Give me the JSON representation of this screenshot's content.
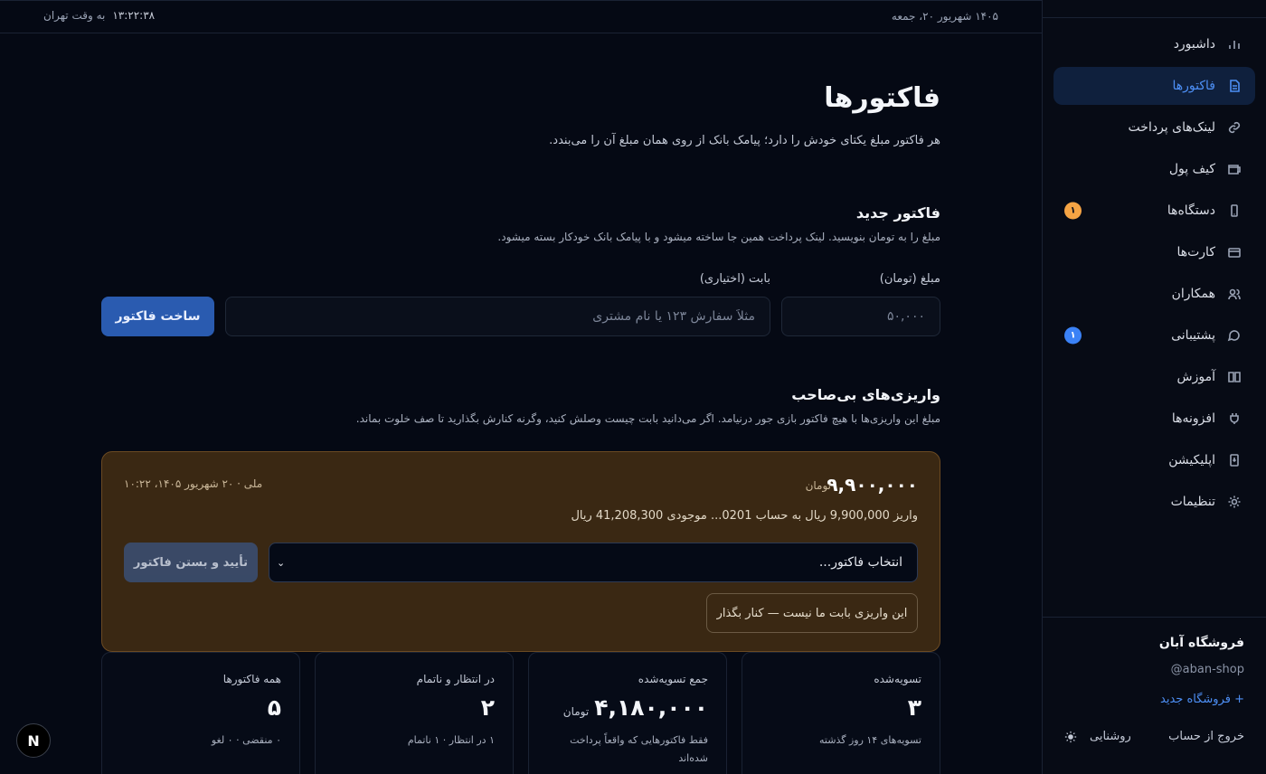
{
  "topbar": {
    "date": "۱۴۰۵ شهریور ۲۰، جمعه",
    "clock": "۱۳:۲۲:۳۸",
    "clock_suffix": "به وقت تهران"
  },
  "sidebar": {
    "items": [
      {
        "label": "داشبورد",
        "icon": "bar-chart-icon"
      },
      {
        "label": "فاکتورها",
        "icon": "document-icon",
        "active": true
      },
      {
        "label": "لینک‌های پرداخت",
        "icon": "link-icon"
      },
      {
        "label": "کیف پول",
        "icon": "wallet-icon"
      },
      {
        "label": "دستگاه‌ها",
        "icon": "phone-icon",
        "badge": "۱"
      },
      {
        "label": "کارت‌ها",
        "icon": "card-icon"
      },
      {
        "label": "همکاران",
        "icon": "users-icon"
      },
      {
        "label": "پشتیبانی",
        "icon": "chat-icon",
        "badge": "۱"
      },
      {
        "label": "آموزش",
        "icon": "book-icon"
      },
      {
        "label": "افزونه‌ها",
        "icon": "plug-icon"
      },
      {
        "label": "اپلیکیشن",
        "icon": "app-icon"
      },
      {
        "label": "تنظیمات",
        "icon": "gear-icon"
      }
    ],
    "shop_name": "فروشگاه آبان",
    "shop_handle": "@aban-shop",
    "new_shop": "+ فروشگاه جدید",
    "logout": "خروج از حساب",
    "theme": "روشنایی"
  },
  "page": {
    "title": "فاکتورها",
    "subtitle": "هر فاکتور مبلغ یکتای خودش را دارد؛ پیامک بانک از روی همان مبلغ آن را می‌بندد."
  },
  "new_invoice": {
    "title": "فاکتور جدید",
    "desc": "مبلغ را به تومان بنویسید. لینک پرداخت همین جا ساخته میشود و با پیامک بانک خودکار بسته میشود.",
    "amount_label": "مبلغ (تومان)",
    "amount_placeholder": "۵۰,۰۰۰",
    "desc_label": "بابت (اختیاری)",
    "desc_placeholder": "مثلاً سفارش ۱۲۳ یا نام مشتری",
    "create_label": "ساخت فاکتور"
  },
  "orphan": {
    "title": "واریزی‌های بی‌صاحب",
    "desc": "مبلغ این واریزی‌ها با هیچ فاکتور بازی جور درنیامد. اگر می‌دانید بابت چیست وصلش کنید، وگرنه کنارش بگذارید تا صف خلوت بماند.",
    "amount": "۹,۹۰۰,۰۰۰",
    "unit": "تومان",
    "meta": "ملی · ۲۰ شهریور ۱۴۰۵، ۱۰:۲۲",
    "sms": "واریز 9,900,000 ریال به حساب 0201... موجودی 41,208,300 ریال",
    "select_placeholder": "انتخاب فاکتور...",
    "confirm_label": "تأیید و بستن فاکتور",
    "dismiss_label": "این واریزی بابت ما نیست — کنار بگذار"
  },
  "stats": [
    {
      "title": "تسویه‌شده",
      "value": "۳",
      "sub": "تسویه‌های ۱۴ روز گذشته"
    },
    {
      "title": "جمع تسویه‌شده",
      "value": "۴,۱۸۰,۰۰۰",
      "unit": "تومان",
      "sub": "فقط فاکتورهایی که واقعاً پرداخت شده‌اند"
    },
    {
      "title": "در انتظار و ناتمام",
      "value": "۲",
      "sub": "۱ در انتظار · ۱ ناتمام"
    },
    {
      "title": "همه فاکتورها",
      "value": "۵",
      "sub": "۰ منقضی · ۰ لغو"
    }
  ],
  "next_badge": "N"
}
